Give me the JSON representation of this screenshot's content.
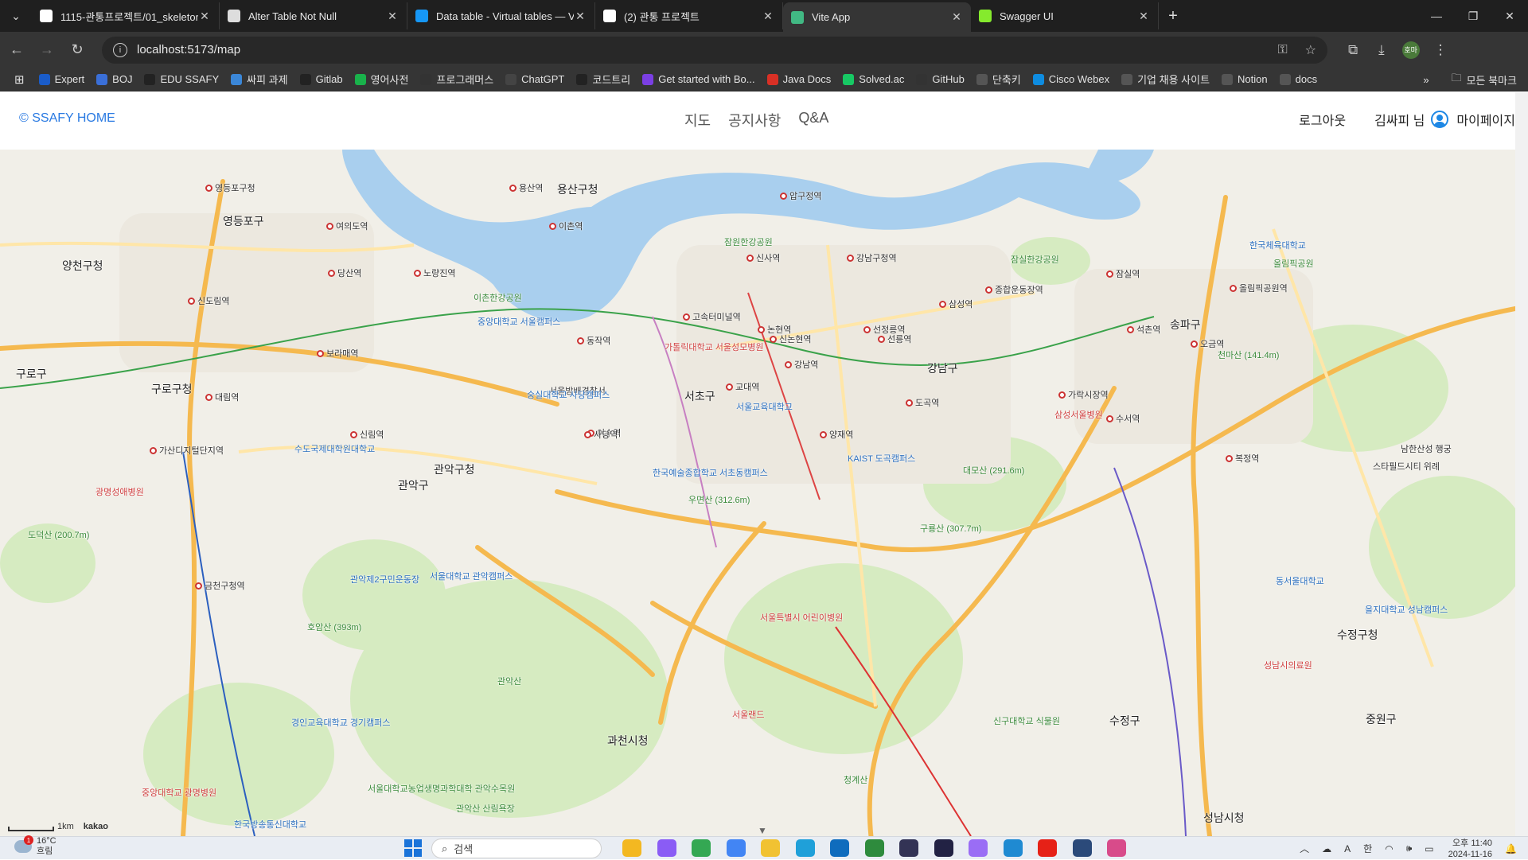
{
  "browser": {
    "tabs": [
      {
        "title": "1115-관통프로젝트/01_skeleton",
        "icon": "github-icon",
        "active": false
      },
      {
        "title": "Alter Table Not Null",
        "icon": "openai-icon",
        "active": false
      },
      {
        "title": "Data table - Virtual tables — V",
        "icon": "vuetify-icon",
        "active": false
      },
      {
        "title": "(2) 관통 프로젝트",
        "icon": "notion-icon",
        "active": false
      },
      {
        "title": "Vite App",
        "icon": "vue-icon",
        "active": true
      },
      {
        "title": "Swagger UI",
        "icon": "swagger-icon",
        "active": false
      }
    ],
    "url": "localhost:5173/map",
    "profile_initials": "호마",
    "bookmarks": [
      {
        "label": "Expert",
        "icon": "samsung-icon",
        "color": "#1a5cc9"
      },
      {
        "label": "BOJ",
        "icon": "boj-icon",
        "color": "#3a6fd8"
      },
      {
        "label": "EDU SSAFY",
        "icon": "ssafy-icon",
        "color": "#222222"
      },
      {
        "label": "싸피 과제",
        "icon": "ssafy-icon",
        "color": "#3b87d8"
      },
      {
        "label": "Gitlab",
        "icon": "gitlab-icon",
        "color": "#222222"
      },
      {
        "label": "영어사전",
        "icon": "dictionary-icon",
        "color": "#19b24b"
      },
      {
        "label": "프로그래머스",
        "icon": "programmers-icon",
        "color": "#333333"
      },
      {
        "label": "ChatGPT",
        "icon": "openai-icon",
        "color": "#444444"
      },
      {
        "label": "코드트리",
        "icon": "codetree-icon",
        "color": "#222222"
      },
      {
        "label": "Get started with Bo...",
        "icon": "bootstrap-icon",
        "color": "#7b3fe4"
      },
      {
        "label": "Java Docs",
        "icon": "java-icon",
        "color": "#d93025"
      },
      {
        "label": "Solved.ac",
        "icon": "solvedac-icon",
        "color": "#17c964"
      },
      {
        "label": "GitHub",
        "icon": "github-icon",
        "color": "#333333"
      },
      {
        "label": "단축키",
        "icon": "folder-icon",
        "color": "#555555"
      },
      {
        "label": "Cisco Webex",
        "icon": "webex-icon",
        "color": "#0e8ce0"
      },
      {
        "label": "기업 채용 사이트",
        "icon": "folder-icon",
        "color": "#555555"
      },
      {
        "label": "Notion",
        "icon": "notion-icon",
        "color": "#555555"
      },
      {
        "label": "docs",
        "icon": "folder-icon",
        "color": "#555555"
      }
    ],
    "all_bookmarks": "모든 북마크"
  },
  "header": {
    "brand": "© SSAFY HOME",
    "nav": [
      "지도",
      "공지사항",
      "Q&A"
    ],
    "logout": "로그아웃",
    "user_greeting": "김싸피 님",
    "mypage": "마이페이지"
  },
  "map": {
    "scale_label": "1km",
    "provider": "kakao",
    "labels": [
      {
        "text": "영등포구청",
        "cls": "lbl",
        "station": true
      },
      {
        "text": "영등포구",
        "cls": "lbl big"
      },
      {
        "text": "용산역",
        "cls": "lbl",
        "station": true
      },
      {
        "text": "용산구청",
        "cls": "lbl big"
      },
      {
        "text": "여의도역",
        "cls": "lbl",
        "station": true
      },
      {
        "text": "이촌역",
        "cls": "lbl",
        "station": true
      },
      {
        "text": "잠원한강공원",
        "cls": "lbl green"
      },
      {
        "text": "압구정역",
        "cls": "lbl",
        "station": true
      },
      {
        "text": "잠실한강공원",
        "cls": "lbl green"
      },
      {
        "text": "한국체육대학교",
        "cls": "lbl blue"
      },
      {
        "text": "올림픽공원",
        "cls": "lbl green"
      },
      {
        "text": "양천구청",
        "cls": "lbl big"
      },
      {
        "text": "당산역",
        "cls": "lbl",
        "station": true
      },
      {
        "text": "노량진역",
        "cls": "lbl",
        "station": true
      },
      {
        "text": "이촌한강공원",
        "cls": "lbl green"
      },
      {
        "text": "신사역",
        "cls": "lbl",
        "station": true
      },
      {
        "text": "강남구청역",
        "cls": "lbl",
        "station": true
      },
      {
        "text": "종합운동장역",
        "cls": "lbl",
        "station": true
      },
      {
        "text": "잠실역",
        "cls": "lbl",
        "station": true
      },
      {
        "text": "올림픽공원역",
        "cls": "lbl",
        "station": true
      },
      {
        "text": "신도림역",
        "cls": "lbl",
        "station": true
      },
      {
        "text": "중앙대학교 서울캠퍼스",
        "cls": "lbl blue"
      },
      {
        "text": "고속터미널역",
        "cls": "lbl",
        "station": true
      },
      {
        "text": "논현역",
        "cls": "lbl",
        "station": true
      },
      {
        "text": "선정릉역",
        "cls": "lbl",
        "station": true
      },
      {
        "text": "삼성역",
        "cls": "lbl",
        "station": true
      },
      {
        "text": "석촌역",
        "cls": "lbl",
        "station": true
      },
      {
        "text": "송파구",
        "cls": "lbl big"
      },
      {
        "text": "구로구",
        "cls": "lbl big"
      },
      {
        "text": "동작역",
        "cls": "lbl",
        "station": true
      },
      {
        "text": "가톨릭대학교 서울성모병원",
        "cls": "lbl red"
      },
      {
        "text": "신논현역",
        "cls": "lbl",
        "station": true
      },
      {
        "text": "선릉역",
        "cls": "lbl",
        "station": true
      },
      {
        "text": "오금역",
        "cls": "lbl",
        "station": true
      },
      {
        "text": "천마산 (141.4m)",
        "cls": "lbl green"
      },
      {
        "text": "구로구청",
        "cls": "lbl big"
      },
      {
        "text": "보라매역",
        "cls": "lbl",
        "station": true
      },
      {
        "text": "서울방배경찰서",
        "cls": "lbl"
      },
      {
        "text": "강남역",
        "cls": "lbl",
        "station": true
      },
      {
        "text": "강남구",
        "cls": "lbl big"
      },
      {
        "text": "도곡역",
        "cls": "lbl",
        "station": true
      },
      {
        "text": "삼성서울병원",
        "cls": "lbl red"
      },
      {
        "text": "가락시장역",
        "cls": "lbl",
        "station": true
      },
      {
        "text": "대림역",
        "cls": "lbl",
        "station": true
      },
      {
        "text": "숭실대학교 사당캠퍼스",
        "cls": "lbl blue"
      },
      {
        "text": "서초구",
        "cls": "lbl big"
      },
      {
        "text": "교대역",
        "cls": "lbl",
        "station": true
      },
      {
        "text": "서울교육대학교",
        "cls": "lbl blue"
      },
      {
        "text": "수서역",
        "cls": "lbl",
        "station": true
      },
      {
        "text": "가산디지털단지역",
        "cls": "lbl",
        "station": true
      },
      {
        "text": "신림역",
        "cls": "lbl",
        "station": true
      },
      {
        "text": "이수역",
        "cls": "lbl",
        "station": true
      },
      {
        "text": "양재역",
        "cls": "lbl",
        "station": true
      },
      {
        "text": "KAIST 도곡캠퍼스",
        "cls": "lbl blue"
      },
      {
        "text": "남한산성 행궁",
        "cls": "lbl"
      },
      {
        "text": "수도국제대학원대학교",
        "cls": "lbl blue"
      },
      {
        "text": "관악구청",
        "cls": "lbl big"
      },
      {
        "text": "사당역",
        "cls": "lbl",
        "station": true
      },
      {
        "text": "한국예술종합학교 서초동캠퍼스",
        "cls": "lbl blue"
      },
      {
        "text": "대모산 (291.6m)",
        "cls": "lbl green"
      },
      {
        "text": "스타필드시티 위례",
        "cls": "lbl"
      },
      {
        "text": "광명성애병원",
        "cls": "lbl red"
      },
      {
        "text": "관악구",
        "cls": "lbl big"
      },
      {
        "text": "우면산 (312.6m)",
        "cls": "lbl green"
      },
      {
        "text": "구룡산 (307.7m)",
        "cls": "lbl green"
      },
      {
        "text": "복정역",
        "cls": "lbl",
        "station": true
      },
      {
        "text": "도덕산 (200.7m)",
        "cls": "lbl green"
      },
      {
        "text": "금천구청역",
        "cls": "lbl",
        "station": true
      },
      {
        "text": "서울대학교 관악캠퍼스",
        "cls": "lbl blue"
      },
      {
        "text": "서울특별시 어린이병원",
        "cls": "lbl red"
      },
      {
        "text": "동서울대학교",
        "cls": "lbl blue"
      },
      {
        "text": "을지대학교 성남캠퍼스",
        "cls": "lbl blue"
      },
      {
        "text": "관악제2구민운동장",
        "cls": "lbl blue"
      },
      {
        "text": "호암산 (393m)",
        "cls": "lbl green"
      },
      {
        "text": "수정구청",
        "cls": "lbl big"
      },
      {
        "text": "성남시의료원",
        "cls": "lbl red"
      },
      {
        "text": "관악산",
        "cls": "lbl green"
      },
      {
        "text": "서울랜드",
        "cls": "lbl red"
      },
      {
        "text": "신구대학교 식물원",
        "cls": "lbl green"
      },
      {
        "text": "수정구",
        "cls": "lbl big"
      },
      {
        "text": "중원구",
        "cls": "lbl big"
      },
      {
        "text": "경인교육대학교 경기캠퍼스",
        "cls": "lbl blue"
      },
      {
        "text": "과천시청",
        "cls": "lbl big"
      },
      {
        "text": "청계산",
        "cls": "lbl green"
      },
      {
        "text": "중앙대학교 광명병원",
        "cls": "lbl red"
      },
      {
        "text": "서울대학교농업생명과학대학 관악수목원",
        "cls": "lbl green"
      },
      {
        "text": "성남시청",
        "cls": "lbl big"
      },
      {
        "text": "관악산 산림욕장",
        "cls": "lbl green"
      },
      {
        "text": "한국방송통신대학교",
        "cls": "lbl blue"
      }
    ]
  },
  "taskbar": {
    "weather_temp": "16°C",
    "weather_desc": "흐림",
    "weather_badge": "1",
    "search_placeholder": "검색",
    "ime_a": "A",
    "ime_lang": "한",
    "clock_time": "오후 11:40",
    "clock_date": "2024-11-16",
    "apps": [
      {
        "name": "file-explorer-icon",
        "color": "#f3b821"
      },
      {
        "name": "copilot-icon",
        "color": "#8a5cf5"
      },
      {
        "name": "chrome-icon",
        "color": "#34a853"
      },
      {
        "name": "chrome-dev-icon",
        "color": "#4285f4"
      },
      {
        "name": "folder-icon",
        "color": "#f1c232"
      },
      {
        "name": "edge-icon",
        "color": "#1fa0d9"
      },
      {
        "name": "outlook-icon",
        "color": "#0f6cbd"
      },
      {
        "name": "terminal-icon",
        "color": "#2e8b3d"
      },
      {
        "name": "obs-icon",
        "color": "#333355"
      },
      {
        "name": "webex-icon",
        "color": "#222244"
      },
      {
        "name": "ai-app-icon",
        "color": "#9a6df5"
      },
      {
        "name": "vscode-icon",
        "color": "#1f8ad2"
      },
      {
        "name": "youtube-icon",
        "color": "#e62117"
      },
      {
        "name": "remote-desktop-icon",
        "color": "#2b4a7a"
      },
      {
        "name": "snipping-tool-icon",
        "color": "#d84b8a"
      }
    ]
  },
  "colors": {
    "accent": "#2a7ae2",
    "road": "#f5b94f",
    "river": "#9fc7ea",
    "park": "#cfe6b4"
  }
}
